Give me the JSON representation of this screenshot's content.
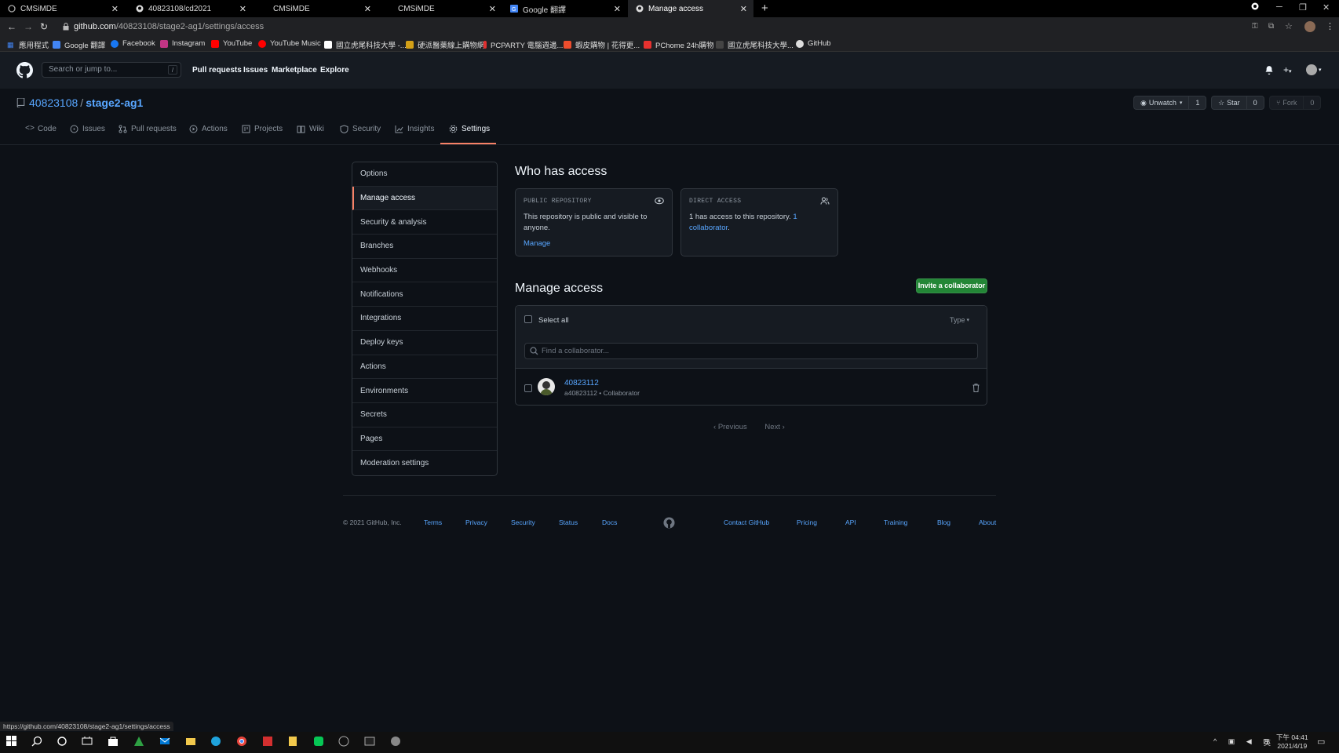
{
  "browser": {
    "tabs": [
      {
        "title": "CMSiMDE",
        "active": false
      },
      {
        "title": "40823108/cd2021",
        "active": false
      },
      {
        "title": "CMSiMDE",
        "active": false
      },
      {
        "title": "CMSiMDE",
        "active": false
      },
      {
        "title": "Google 翻譯",
        "active": false
      },
      {
        "title": "Manage access",
        "active": true
      }
    ],
    "url_host": "github.com",
    "url_path": "/40823108/stage2-ag1/settings/access",
    "bookmarks": [
      "應用程式",
      "Google 翻譯",
      "Facebook",
      "Instagram",
      "YouTube",
      "YouTube Music",
      "國立虎尾科技大學 -...",
      "硬派醫藥線上購物網",
      "PCPARTY 電腦週邊...",
      "蝦皮購物 | 花得更...",
      "PChome 24h購物",
      "國立虎尾科技大學...",
      "GitHub"
    ],
    "status_url": "https://github.com/40823108/stage2-ag1/settings/access"
  },
  "github": {
    "search_placeholder": "Search or jump to...",
    "search_key": "/",
    "nav": [
      "Pull requests",
      "Issues",
      "Marketplace",
      "Explore"
    ],
    "repo": {
      "owner": "40823108",
      "separator": "/",
      "name": "stage2-ag1",
      "unwatch_label": "Unwatch",
      "watch_count": "1",
      "star_label": "Star",
      "star_count": "0",
      "fork_label": "Fork",
      "fork_count": "0"
    },
    "repo_tabs": [
      "Code",
      "Issues",
      "Pull requests",
      "Actions",
      "Projects",
      "Wiki",
      "Security",
      "Insights",
      "Settings"
    ],
    "settings_menu": [
      "Options",
      "Manage access",
      "Security & analysis",
      "Branches",
      "Webhooks",
      "Notifications",
      "Integrations",
      "Deploy keys",
      "Actions",
      "Environments",
      "Secrets",
      "Pages",
      "Moderation settings"
    ],
    "who_has_access": {
      "heading": "Who has access",
      "public_caption": "PUBLIC REPOSITORY",
      "public_text": "This repository is public and visible to anyone.",
      "public_link": "Manage",
      "direct_caption": "DIRECT ACCESS",
      "direct_text": "1 has access to this repository.",
      "direct_link": "1 collaborator",
      "direct_end": "."
    },
    "manage_access": {
      "heading": "Manage access",
      "invite_button": "Invite a collaborator",
      "select_all": "Select all",
      "type_filter": "Type",
      "find_placeholder": "Find a collaborator...",
      "members": [
        {
          "login": "40823112",
          "subtitle": "a40823112 • Collaborator"
        }
      ],
      "previous": "Previous",
      "next": "Next"
    },
    "footer": {
      "copyright": "© 2021 GitHub, Inc.",
      "links": [
        "Terms",
        "Privacy",
        "Security",
        "Status",
        "Docs",
        "Contact GitHub",
        "Pricing",
        "API",
        "Training",
        "Blog",
        "About"
      ]
    }
  },
  "taskbar": {
    "time": "下午 04:41",
    "date": "2021/4/19",
    "ime": "英"
  },
  "colors": {
    "accent": "#f78166",
    "link": "#58a6ff",
    "green": "#238636",
    "bg": "#0d1117"
  }
}
